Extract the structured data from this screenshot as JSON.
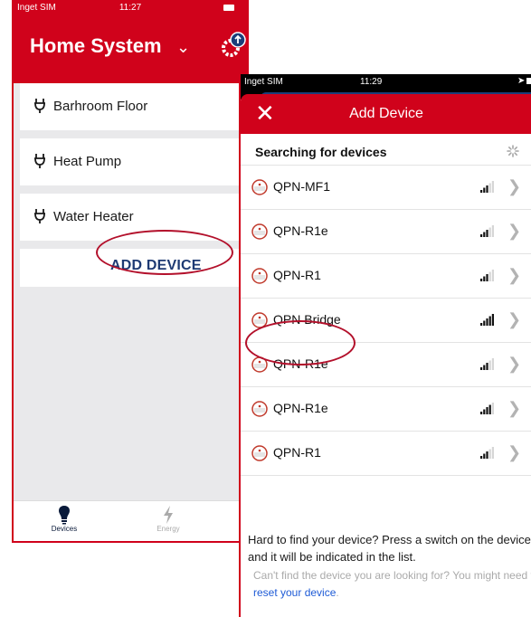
{
  "left_screen": {
    "status": {
      "carrier": "Inget SIM",
      "time": "11:27"
    },
    "title": "Home System",
    "devices": [
      {
        "label": "Barhroom Floor"
      },
      {
        "label": "Heat Pump"
      },
      {
        "label": "Water Heater"
      }
    ],
    "add_device_label": "ADD DEVICE",
    "tabs": {
      "devices": "Devices",
      "energy": "Energy"
    }
  },
  "right_screen": {
    "status": {
      "carrier": "Inget SIM",
      "time": "11:29"
    },
    "header_title": "Add Device",
    "searching_label": "Searching for devices",
    "devices": [
      {
        "name": "QPN-MF1",
        "signal_bars": 3
      },
      {
        "name": "QPN-R1e",
        "signal_bars": 3
      },
      {
        "name": "QPN-R1",
        "signal_bars": 3
      },
      {
        "name": "QPN Bridge",
        "signal_bars": 5
      },
      {
        "name": "QPN-R1e",
        "signal_bars": 3
      },
      {
        "name": "QPN-R1e",
        "signal_bars": 4
      },
      {
        "name": "QPN-R1",
        "signal_bars": 3
      }
    ],
    "hint_main": "Hard to find your device? Press a switch on the device and it will be indicated in the list.",
    "hint_sub": "Can't find the device you are looking for? You might need to",
    "hint_link": "reset your device",
    "hint_end": "."
  },
  "colors": {
    "brand_red": "#d0021b",
    "navy": "#1e3a73",
    "link_blue": "#1e5bd6",
    "annotation": "#b3102b"
  }
}
